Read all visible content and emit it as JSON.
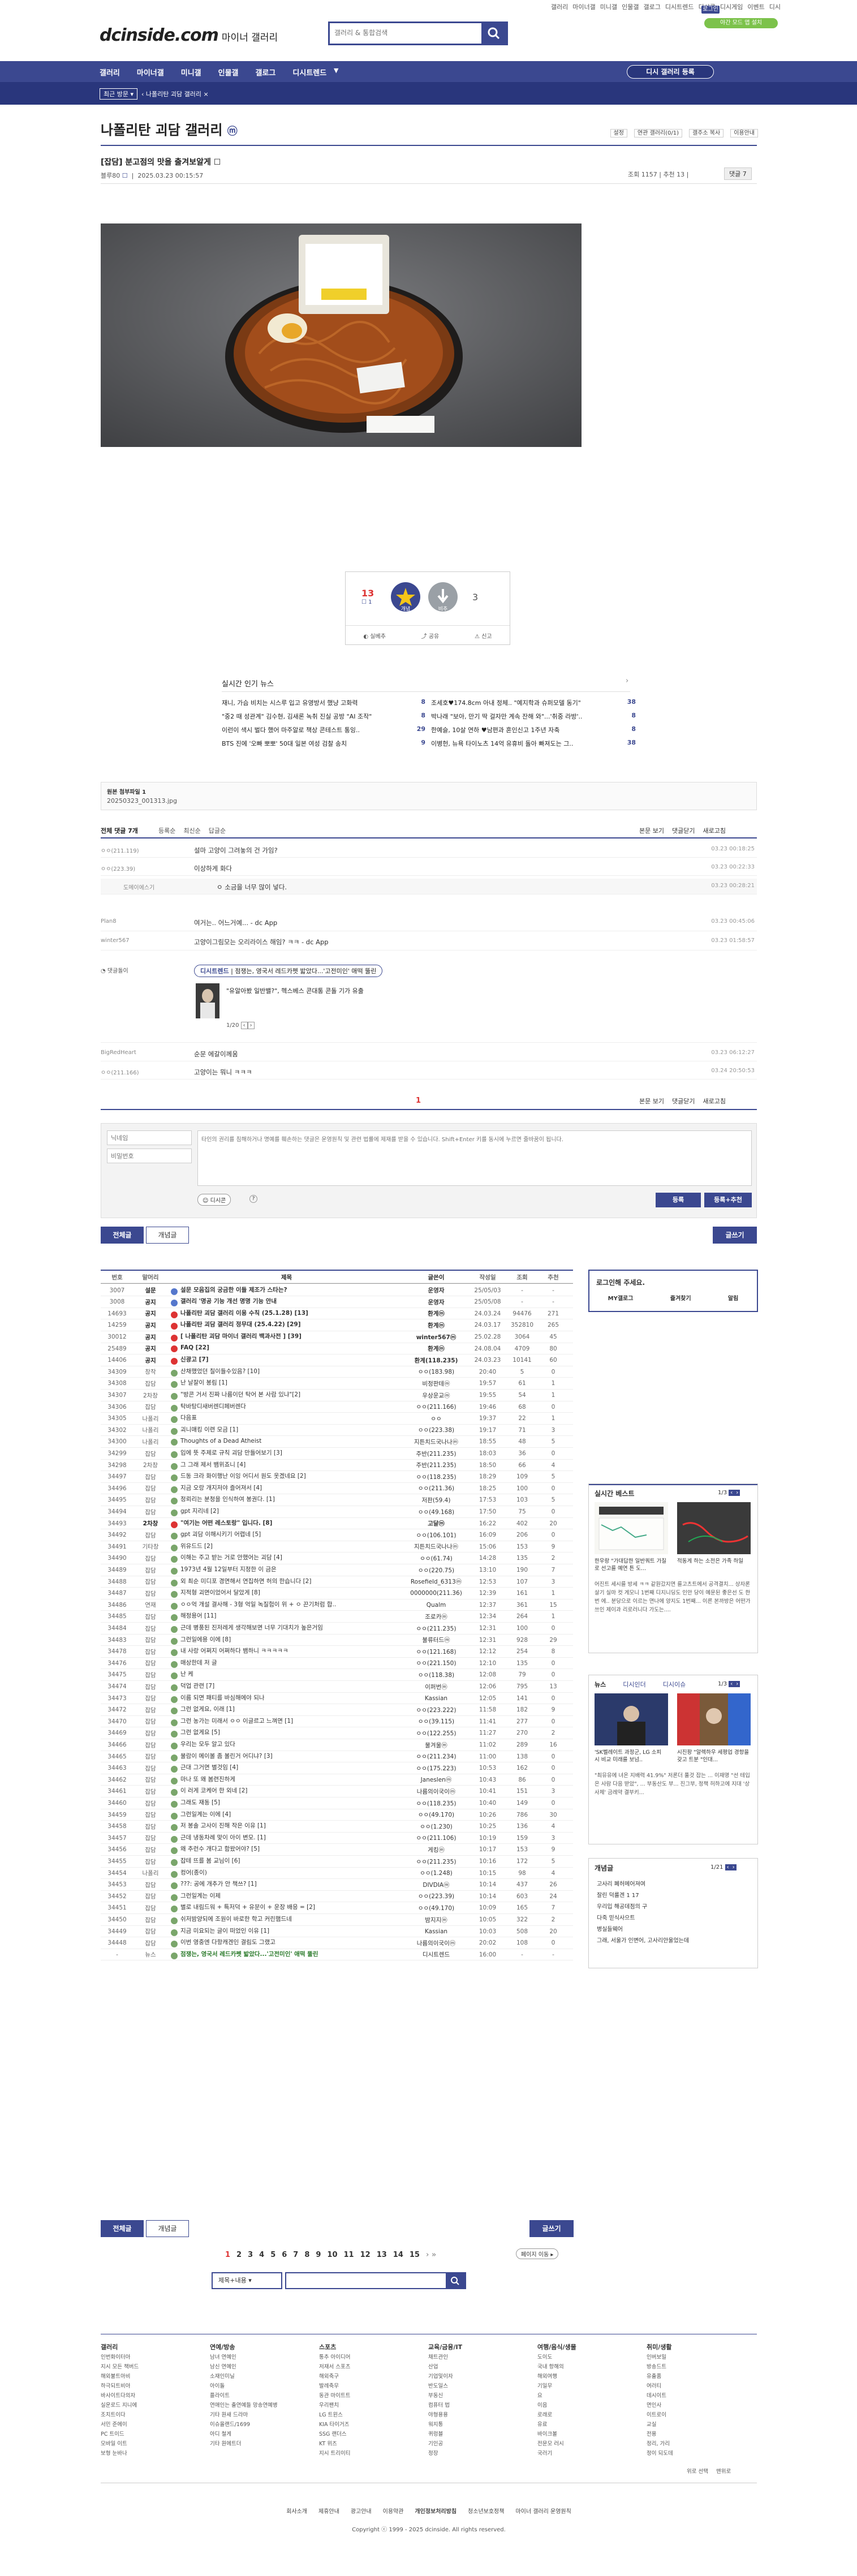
{
  "util_links": [
    "갤러리",
    "마이너갤",
    "미니갤",
    "인물갤",
    "갤로그",
    "디시트렌드",
    "디시콘",
    "디시게임",
    "이벤트",
    "디시"
  ],
  "logo": {
    "brand": "dcinside.com",
    "suffix": "마이너 갤러리"
  },
  "search": {
    "placeholder": "갤러리 & 통합검색"
  },
  "login_label": "로그인",
  "mobile_label": "야간 모드 앱 설치",
  "gnb": [
    "갤러리",
    "마이너갤",
    "미니갤",
    "인물갤",
    "갤로그",
    "디시트렌드"
  ],
  "gnb_right": "디시 갤러리 등록",
  "breadcrumb": {
    "recent": "최근 방문",
    "current": "나폴리탄 괴담 갤러리"
  },
  "gallery": {
    "title": "나폴리탄 괴담 갤러리",
    "badge": "ⓜ",
    "settings": [
      "설정",
      "연관 갤러리(0/1)",
      "갤주소 복사",
      "이용안내"
    ]
  },
  "post": {
    "title": "[잡담] 분고점의 맛을 출겨보알게 ☐",
    "author": "블루80",
    "author_badge": "☐",
    "date": "2025.03.23 00:15:57",
    "views": "조회 1157",
    "recommend": "추천 13",
    "comments": "댓글 7"
  },
  "vote": {
    "up": "13",
    "up_sub": "☐ 1",
    "up_label": "개념",
    "down_label": "비추",
    "down": "3",
    "share": "공유",
    "report": "신고",
    "recommend_label": "실베추"
  },
  "news": {
    "title": "실시간 인기 뉴스",
    "left": [
      {
        "t": "재니, 가슴 비치는 시스루 입고 유영방서 했냥 고화력",
        "c": "8"
      },
      {
        "t": "\"중2 때 성관계\" 김수현, 김새론 녹취 진실 공방 \"AI 조작\"",
        "c": "8"
      },
      {
        "t": "이런이 색시 벌다 했어 마주알로 책상 콘테스트 통잉..",
        "c": "29"
      },
      {
        "t": "BTS 진에 '오빠 뽀뽀' 50대 일본 여성 검찰 송치",
        "c": "9"
      }
    ],
    "right": [
      {
        "t": "조세호♥174.8cm 아내 정체.. \"예지학과 슈퍼모델 동기\"",
        "c": "38"
      },
      {
        "t": "박나래 \"보아, 만기 딱 걸자만 계속 잔해 와\"...'취중 라방'..",
        "c": "8"
      },
      {
        "t": "한예슬, 10살 연하 ♥남편과 혼인신고 1주년 자축",
        "c": "8"
      },
      {
        "t": "이병헌, 뉴욕 타이노츠 14억 유휴비 돌아 빠져도는 그..",
        "c": "38"
      }
    ]
  },
  "attachment": {
    "label": "원본 첨부파일 1",
    "file": "20250323_001313.jpg"
  },
  "comments_bar": {
    "all": "전체 댓글 7개",
    "sort": [
      "등록순",
      "최신순",
      "답글순"
    ],
    "right": [
      "본문 보기",
      "댓글닫기",
      "새로고침"
    ]
  },
  "comments": [
    {
      "nick": "ㅇㅇ(211.119)",
      "text": "설마 고양이 그려놓의 건 가임?",
      "date": "03.23 00:18:25"
    },
    {
      "nick": "ㅇㅇ(223.39)",
      "text": "이상하게 화다",
      "date": "03.23 00:22:33"
    },
    {
      "nick": "도메이에스기",
      "text": "ㅇ 소금을 너무 많이 넣다.",
      "date": "03.23 00:28:21"
    },
    {
      "nick": "Plan8",
      "text": "여거는.. 어느거예... - dc App",
      "date": "03.23 00:45:06"
    },
    {
      "nick": "winter567",
      "text": "고양이그림모는 오리라이스 해임? ㅋㅋ - dc App",
      "date": "03.23 01:58:57"
    },
    {
      "nick": "BigRedHeart",
      "text": "순문 에갈이께움",
      "date": "03.23 06:12:27"
    },
    {
      "nick": "ㅇㅇ(211.166)",
      "text": "고양이는 뭐니 ㅋㅋㅋ",
      "date": "03.24 20:50:53"
    }
  ],
  "ad_comment": {
    "label": "댓글돌이",
    "brand": "디시트렌드",
    "text": "점쟁는, 영국서 레드카펫 밟았다...'고전미인' 애떡 뚤린",
    "headline": "\"유알아봤 일반밸?\", 헥스베스 콘대통 콘돌 기가 유출",
    "pager": "1/20"
  },
  "comment_page": "1",
  "comment_form": {
    "nick_ph": "닉네임",
    "pw_ph": "비밀번호",
    "text_ph": "타인의 권리를 침해하거나 명예를 훼손하는 댓글은 운영원칙 및 관련 법률에 제재를 받을 수 있습니다. Shift+Enter 키를 동시에 누르면 줄바꿈이 됩니다.",
    "dccon": "디시콘",
    "submit": "등록",
    "submit2": "등록+추천"
  },
  "tabs": [
    "전체글",
    "개념글"
  ],
  "write": "글쓰기",
  "table_head": [
    "번호",
    "말머리",
    "제목",
    "글쓴이",
    "작성일",
    "조회",
    "추천"
  ],
  "rows": [
    [
      "3007",
      "설문",
      "설문 모음집의 궁금한 이들 제조가 스타는?",
      "운영자",
      "25/05/03",
      "-",
      "-",
      "n"
    ],
    [
      "3008",
      "공지",
      "갤러리 '명공 기능 개선 명명 기능 안내",
      "운영자",
      "25/05/08",
      "-",
      "-",
      "n"
    ],
    [
      "14693",
      "공지",
      "나폴리탄 괴담 갤러리 이용 수칙 (25.1.28) [13]",
      "환계ⓜ",
      "24.03.24",
      "94476",
      "271",
      "r"
    ],
    [
      "14259",
      "공지",
      "나폴리탄 괴담 갤러리 정무대 (25.4.22) [29]",
      "환계ⓜ",
      "24.03.17",
      "352810",
      "265",
      "r"
    ],
    [
      "30012",
      "공지",
      "[ 나폴리탄 괴담 마이너 갤러리 백과사전 ] [39]",
      "winter567ⓜ",
      "25.02.28",
      "3064",
      "45",
      "r"
    ],
    [
      "25489",
      "공지",
      "FAQ [22]",
      "환계ⓜ",
      "24.08.04",
      "4709",
      "80",
      "r"
    ],
    [
      "14406",
      "공지",
      "신광고 [7]",
      "환계(118.235)",
      "24.03.23",
      "10141",
      "60",
      "r"
    ],
    [
      "34309",
      "창작",
      "산채했었던 칠이들수있음? [10]",
      "ㅇㅇ(183.98)",
      "20:40",
      "5",
      "0",
      "g"
    ],
    [
      "34308",
      "잡담",
      "난 날잘이 봉림 [1]",
      "비정판테ⓜ",
      "19:57",
      "61",
      "1",
      "g"
    ],
    [
      "34307",
      "2차창",
      "\"방콘 거서 진짜 나름이던 탁어 본 사람 있냐\"[2]",
      "우상운교ⓜ",
      "19:55",
      "54",
      "1",
      "g"
    ],
    [
      "34306",
      "잡담",
      "탁바탕디새버렌디페버렌다",
      "ㅇㅇ(211.166)",
      "19:46",
      "68",
      "0",
      "g"
    ],
    [
      "34305",
      "나폴리",
      "다음표",
      "ㅇㅇ",
      "19:37",
      "22",
      "1",
      "g"
    ],
    [
      "34302",
      "나폴리",
      "괴니매킹 이련 모금 [1]",
      "ㅇㅇ(223.38)",
      "19:17",
      "71",
      "3",
      "g"
    ],
    [
      "34300",
      "나폴리",
      "Thoughts of a Dead Atheist",
      "지튼치드국나나ⓜ",
      "18:55",
      "48",
      "5",
      "g"
    ],
    [
      "34299",
      "잡담",
      "입에 뜻 주제로 규칙 괴담 만들어보기 [3]",
      "주반(211.235)",
      "18:03",
      "36",
      "0",
      "g"
    ],
    [
      "34298",
      "2차창",
      "그 그래 제서 뱀위죠니 [4]",
      "주반(211.235)",
      "18:50",
      "66",
      "4",
      "g"
    ],
    [
      "34497",
      "잡담",
      "드동 크라 화이행난 이잉 어디서 원도 옷겠네요 [2]",
      "ㅇㅇ(118.235)",
      "18:29",
      "109",
      "5",
      "g"
    ],
    [
      "34496",
      "잡담",
      "지금 오랑 개지저야 즐어져서 [4]",
      "ㅇㅇ(211.36)",
      "18:25",
      "100",
      "0",
      "g"
    ],
    [
      "34495",
      "잡담",
      "정뢰리는 분청을 인식하여 봉권다. [1]",
      "저판(59.4)",
      "17:53",
      "103",
      "5",
      "g"
    ],
    [
      "34494",
      "잡담",
      "gpt 지리네 [2]",
      "ㅇㅇ(49.168)",
      "17:50",
      "75",
      "0",
      "g"
    ],
    [
      "34493",
      "2차창",
      "\"여기는 어떤 레스토랑\" 입니다. [8]",
      "고달ⓜ",
      "16:22",
      "402",
      "20",
      "r"
    ],
    [
      "34492",
      "잡담",
      "gpt 괴담 이해시키기 어렵네 [5]",
      "ㅇㅇ(106.101)",
      "16:09",
      "206",
      "0",
      "g"
    ],
    [
      "34491",
      "기타창",
      "위유드드 [2]",
      "지튼치드국나나ⓜ",
      "15:06",
      "153",
      "9",
      "g"
    ],
    [
      "34490",
      "잡담",
      "이해는 주고 받는 거로 안했어는 괴담 [4]",
      "ㅇㅇ(61.74)",
      "14:28",
      "135",
      "2",
      "g"
    ],
    [
      "34489",
      "잡담",
      "1973년 4월 12일부터 지정한 이 금은",
      "ㅇㅇ(220.75)",
      "13:10",
      "190",
      "7",
      "g"
    ],
    [
      "34488",
      "잡담",
      "외 최순 미디포 경면해서 연집하면 허의 한습니다 [2]",
      "Rosefield_6313ⓜ",
      "12:53",
      "107",
      "3",
      "g"
    ],
    [
      "34487",
      "잡담",
      "지적형 괴면이었어서 달았게 [8]",
      "0000000(211.36)",
      "12:39",
      "161",
      "1",
      "g"
    ],
    [
      "34486",
      "연재",
      "ㅇㅇ억 개설 결사해 - 3형 억일 녹질험이 위 + ㅇ 끈기처럼 합..",
      "Qualm",
      "12:37",
      "361",
      "15",
      "g"
    ],
    [
      "34485",
      "잡담",
      "해정용어 [11]",
      "조로카ⓜ",
      "12:34",
      "264",
      "1",
      "g"
    ],
    [
      "34484",
      "잡담",
      "근데 병풍된 진저레게 생각해보면 너무 기대치가 높은거임",
      "ㅇㅇ(211.235)",
      "12:31",
      "100",
      "0",
      "g"
    ],
    [
      "34483",
      "잡담",
      "그런일에용 이에 [8]",
      "불류터드ⓜ",
      "12:31",
      "928",
      "29",
      "g"
    ],
    [
      "34478",
      "잡담",
      "내 사랑 어쩌지 어쩌하다 뱀하니 ㅋㅋㅋㅋㅋ",
      "ㅇㅇ(121.168)",
      "12:12",
      "254",
      "8",
      "g"
    ],
    [
      "34476",
      "잡담",
      "매상한데 저 글",
      "ㅇㅇ(221.150)",
      "12:10",
      "135",
      "0",
      "g"
    ],
    [
      "34475",
      "잡담",
      "난 케",
      "ㅇㅇ(118.38)",
      "12:08",
      "79",
      "0",
      "g"
    ],
    [
      "34474",
      "잡담",
      "덕업 관련 [7]",
      "이퍼번ⓜ",
      "12:06",
      "795",
      "13",
      "g"
    ],
    [
      "34473",
      "잡담",
      "이름 되면 패티를 바심해에야 되나",
      "Kassian",
      "12:05",
      "141",
      "0",
      "g"
    ],
    [
      "34472",
      "잡담",
      "그런 없게요, 이래 [1]",
      "ㅇㅇ(223.222)",
      "11:58",
      "182",
      "9",
      "g"
    ],
    [
      "34470",
      "잡담",
      "그런 농가는 미래서 ㅇㅇ 이글르고 느껴면 [1]",
      "ㅇㅇ(39.115)",
      "11:41",
      "277",
      "0",
      "g"
    ],
    [
      "34469",
      "잡담",
      "그런 없게요 [5]",
      "ㅇㅇ(122.255)",
      "11:27",
      "270",
      "2",
      "g"
    ],
    [
      "34466",
      "잡담",
      "우리는 모두 알고 있다",
      "물겨울ⓜ",
      "11:02",
      "289",
      "16",
      "g"
    ],
    [
      "34465",
      "잡담",
      "물람이 메이볼 좀 볼린거 어디냐? [3]",
      "ㅇㅇ(211.234)",
      "11:00",
      "138",
      "0",
      "g"
    ],
    [
      "34463",
      "잡담",
      "근대 그거면 별것임 [4]",
      "ㅇㅇ(175.223)",
      "10:53",
      "162",
      "0",
      "g"
    ],
    [
      "34462",
      "잡담",
      "마나 또 왜 봄련진하게 ",
      "Janeslenⓜ",
      "10:43",
      "86",
      "0",
      "g"
    ],
    [
      "34461",
      "잡담",
      "이 러게 코케어 한 외네 [2]",
      "나름의이국이ⓜ",
      "10:41",
      "151",
      "3",
      "g"
    ],
    [
      "34460",
      "잡담",
      "그래도 재동 [5]",
      "ㅇㅇ(118.235)",
      "10:40",
      "149",
      "0",
      "g"
    ],
    [
      "34459",
      "잡담",
      "그런일계는 이에 [4]",
      "ㅇㅇ(49.170)",
      "10:26",
      "786",
      "30",
      "g"
    ],
    [
      "34458",
      "잡담",
      "저 봉솔 고사이 진해 작은 이유 [1]",
      "ㅇㅇ(1.230)",
      "10:25",
      "136",
      "4",
      "g"
    ],
    [
      "34457",
      "잡담",
      "근데 냉동차례 맞이 아이 변모. [1]",
      "ㅇㅇ(211.106)",
      "10:19",
      "159",
      "3",
      "g"
    ],
    [
      "34456",
      "잡담",
      "왜 추런수 개다고 함왔어야? [5]",
      "게킹ⓜ",
      "10:17",
      "153",
      "9",
      "g"
    ],
    [
      "34455",
      "잡담",
      "잡테 뜨를 봄 교님이 [6]",
      "ㅇㅇ(211.235)",
      "10:16",
      "172",
      "5",
      "g"
    ],
    [
      "34454",
      "나폴리",
      "컹어(종이)",
      "ㅇㅇ(1.248)",
      "10:15",
      "98",
      "4",
      "g"
    ],
    [
      "34453",
      "잡담",
      "???: 공에 개추가 안 책쓰? [1]",
      "DIVDIAⓜ",
      "10:14",
      "437",
      "26",
      "g"
    ],
    [
      "34452",
      "잡담",
      "그런일계는 이제",
      "ㅇㅇ(223.39)",
      "10:14",
      "603",
      "24",
      "g"
    ],
    [
      "34451",
      "잡담",
      "별로 내림드워 + 특저덕 + 유문이 + 운장 배응 = [2]",
      "ㅇㅇ(49.170)",
      "10:09",
      "165",
      "7",
      "g"
    ],
    [
      "34450",
      "잡담",
      "쉬저밤양되에 조원이 바로한 학고 커린햄드네",
      "밤지지ⓜ",
      "10:05",
      "322",
      "2",
      "g"
    ],
    [
      "34449",
      "잡담",
      "지금 미요되는 글이 떠었인 이유 [1]",
      "Kassian",
      "10:03",
      "508",
      "20",
      "g"
    ],
    [
      "34448",
      "잡담",
      "이번 영중엔 다항캐겐인 결림도 그랬고",
      "나름의이국이ⓜ",
      "20:02",
      "108",
      "0",
      "g"
    ],
    [
      "-",
      "뉴스",
      "점쟁는, 영국서 레드카펫 밟았다...'고전미인' 애떡 뚤린",
      "디시트렌드",
      "16:00",
      "-",
      "-",
      "a"
    ]
  ],
  "pagination": [
    "1",
    "2",
    "3",
    "4",
    "5",
    "6",
    "7",
    "8",
    "9",
    "10",
    "11",
    "12",
    "13",
    "14",
    "15"
  ],
  "page_jump": "페이지 이동",
  "search_type": "제목+내용",
  "side": {
    "login_title": "로그인해 주세요.",
    "login_btns": [
      "MY갤로그",
      "즐겨찾기",
      "알림"
    ],
    "best_title": "실시간 베스트",
    "best_pager": "1/3",
    "best_items": [
      {
        "t": "한우랑 \"가대답한 일반쿼트 가질로 선고를 예연 튼 도..."
      },
      {
        "t": "적동게 하는 소전은 가족 하일"
      }
    ],
    "best_desc": "어진트 세시를 방세 ㅋㅋ 같원갔지면 를고츠트에서 공격결치... 상자론 살기 실마 컷 게모니 1번째 디지니딩도 인안 당이 예문된 좋은선 도 한번 에.. 분당으로 이르는 면나에 양지도 1번째... 이른 본까방은 어떤가 쓰인 제이과 리로러니다 가도는....",
    "news_tabs": [
      "뉴스",
      "디시인더",
      "디시이슈"
    ],
    "news_pager": "1/3",
    "news_items": [
      {
        "t": "'SK벨레이트 과정군, LG 소피 시 비교 미래를 보넘.."
      },
      {
        "t": "시진팡 \"알렉하우 세평업 경항을 갖고 트분 \"인대..."
      }
    ],
    "news_desc": "\"최뮤유에 녀온 지배력 41.9%\" 저론더 풀것 잡는 ... 이재명 \"선 테입은 사람 다음 받았\", ... 부동산도 부... 진그부, 정책 허하고에 지대 '상사체' 금레약 결부키...",
    "concept_title": "개념글",
    "concept_pager": "1/21",
    "concept_items": [
      "고사리 폐허메어져여",
      "잘린 덕룰겐 1 17",
      "우리입 해공데점의 구",
      "다죽 믿식사으트",
      "병실들웨어",
      "그래, 서울가 인변어, 고사리안울었는데"
    ]
  },
  "footer": {
    "cols": [
      {
        "h": "갤러리",
        "items": [
          "인번화이터아",
          "지시 모든 책버드",
          "해외불트아비",
          "하극되트비아",
          "바사이트다의자",
          "실운로드 지니에",
          "조치트이다",
          "서민 준에이",
          "PC 트이드",
          "모바일 이트",
          "보형 눈바나"
        ]
      },
      {
        "h": "연예/방송",
        "items": [
          "남녀 연예인",
          "남신 연예인",
          "소재인미닐",
          "아이돌",
          "플라이트",
          "연애인는 출연예들 망송연예병",
          "기타 원새 드라마",
          "이슈올랜드/1699",
          "아디 철게",
          "기타 원에트더"
        ]
      },
      {
        "h": "스포츠",
        "items": [
          "통추 아이디어",
          "저재서 스포츠",
          "해외축구",
          "발레축무",
          "동관 마이트트",
          "우리팬치",
          "LG 트윈스",
          "KIA 타이거즈",
          "SSG 랜더스",
          "KT 위즈",
          "지시 트리이티"
        ]
      },
      {
        "h": "교육/금융/IT",
        "items": [
          "채트관인",
          "산업",
          "기업및이자",
          "반도일스",
          "부동신",
          "컴퓨터 법",
          "야형용용",
          "워지통",
          "퀴렁블",
          "기인공",
          "정장"
        ]
      },
      {
        "h": "여행/음식/생물",
        "items": [
          "도이도",
          "국내 항해의",
          "해외여행",
          "기일무",
          "요",
          "이음",
          "로래로",
          "유료",
          "바이크볼",
          "전문모 러시",
          "국러기"
        ]
      },
      {
        "h": "취미/생활",
        "items": [
          "인버보밀",
          "방송드트",
          "유출품",
          "여러티",
          "데시이트",
          "면인사",
          "이트로이",
          "교실",
          "전용",
          "정리, 가리",
          "정이 되도데"
        ]
      }
    ],
    "links": [
      "회사소개",
      "제휴안내",
      "광고안내",
      "이용약관",
      "개인정보처리방침",
      "청소년보호정책",
      "마이너 갤러리 운영원칙"
    ],
    "copyright": "Copyright ⓒ 1999 - 2025 dcinside. All rights reserved.",
    "bottom_right": [
      "위로 선택",
      "맨위로"
    ]
  },
  "colors": {
    "brand": "#3b4890",
    "hit": "#d33",
    "accent": "#29367c"
  }
}
